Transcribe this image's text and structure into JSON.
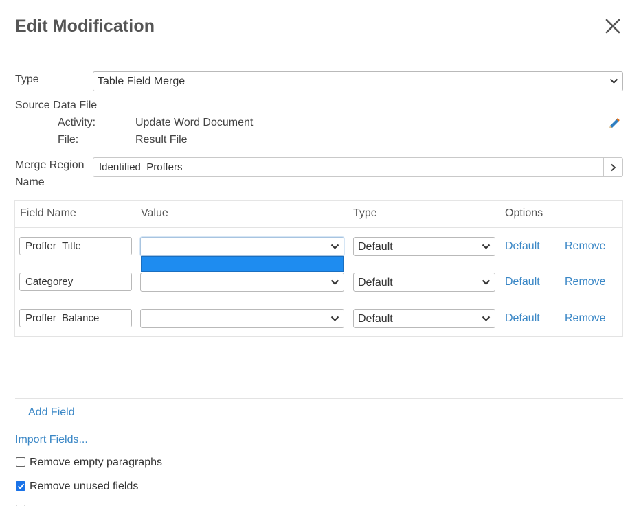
{
  "dialog": {
    "title": "Edit Modification"
  },
  "form": {
    "type_label": "Type",
    "type_value": "Table Field Merge",
    "source_label": "Source Data File",
    "activity_label": "Activity:",
    "activity_value": "Update Word Document",
    "file_label": "File:",
    "file_value": "Result File",
    "merge_label_line1": "Merge Region",
    "merge_label_line2": "Name",
    "merge_value": "Identified_Proffers"
  },
  "grid": {
    "headers": [
      "Field Name",
      "Value",
      "Type",
      "Options"
    ],
    "rows": [
      {
        "field_name": "Proffer_Title_",
        "value": "",
        "type": "Default",
        "option_default": "Default",
        "option_remove": "Remove"
      },
      {
        "field_name": "Categorey",
        "value": "",
        "type": "Default",
        "option_default": "Default",
        "option_remove": "Remove"
      },
      {
        "field_name": "Proffer_Balance",
        "value": "",
        "type": "Default",
        "option_default": "Default",
        "option_remove": "Remove"
      }
    ]
  },
  "actions": {
    "add_field": "Add Field",
    "import_fields": "Import Fields..."
  },
  "options": {
    "remove_empty_paragraphs": {
      "label": "Remove empty paragraphs",
      "checked": false
    },
    "remove_unused_fields": {
      "label": "Remove unused fields",
      "checked": true
    }
  },
  "colors": {
    "link": "#3a87c6",
    "dropdown_highlight": "#1e8cf0",
    "checkbox_checked": "#1a73e8"
  },
  "icons": {
    "close": "close-icon",
    "edit": "pencil-icon",
    "chevron": "chevron-down-icon",
    "arrow": "chevron-right-icon"
  }
}
